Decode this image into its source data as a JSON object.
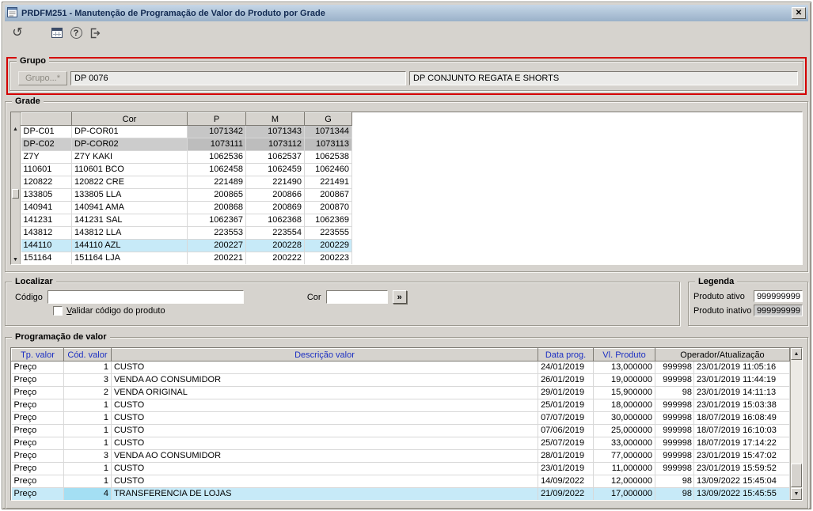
{
  "window": {
    "title": "PRDFM251 - Manutenção de Programação de Valor do Produto por Grade",
    "close_glyph": "✕"
  },
  "toolbar": {
    "icons": [
      "undo-icon",
      "calendar-icon",
      "help-icon",
      "exit-icon"
    ]
  },
  "grupo": {
    "legend": "Grupo",
    "button_label": "Grupo...*",
    "code": "DP 0076",
    "description": "DP CONJUNTO REGATA E SHORTS"
  },
  "grade": {
    "legend": "Grade",
    "headers": {
      "code": "",
      "cor": "Cor",
      "p": "P",
      "m": "M",
      "g": "G"
    },
    "rows": [
      {
        "code": "DP-C01",
        "cor": "DP-COR01",
        "p": "1071342",
        "m": "1071343",
        "g": "1071344",
        "state": "nums-gray"
      },
      {
        "code": "DP-C02",
        "cor": "DP-COR02",
        "p": "1073111",
        "m": "1073112",
        "g": "1073113",
        "state": "row-gray"
      },
      {
        "code": "Z7Y",
        "cor": "Z7Y KAKI",
        "p": "1062536",
        "m": "1062537",
        "g": "1062538",
        "state": ""
      },
      {
        "code": "110601",
        "cor": "110601 BCO",
        "p": "1062458",
        "m": "1062459",
        "g": "1062460",
        "state": ""
      },
      {
        "code": "120822",
        "cor": "120822 CRE",
        "p": "221489",
        "m": "221490",
        "g": "221491",
        "state": ""
      },
      {
        "code": "133805",
        "cor": "133805 LLA",
        "p": "200865",
        "m": "200866",
        "g": "200867",
        "state": ""
      },
      {
        "code": "140941",
        "cor": "140941 AMA",
        "p": "200868",
        "m": "200869",
        "g": "200870",
        "state": ""
      },
      {
        "code": "141231",
        "cor": "141231 SAL",
        "p": "1062367",
        "m": "1062368",
        "g": "1062369",
        "state": ""
      },
      {
        "code": "143812",
        "cor": "143812 LLA",
        "p": "223553",
        "m": "223554",
        "g": "223555",
        "state": ""
      },
      {
        "code": "144110",
        "cor": "144110 AZL",
        "p": "200227",
        "m": "200228",
        "g": "200229",
        "state": "selected"
      },
      {
        "code": "151164",
        "cor": "151164 LJA",
        "p": "200221",
        "m": "200222",
        "g": "200223",
        "state": ""
      }
    ]
  },
  "localizar": {
    "legend": "Localizar",
    "codigo_label": "Código",
    "codigo_value": "",
    "checkbox_label": "Validar código do produto",
    "cor_label": "Cor",
    "cor_value": "",
    "go_label": "»"
  },
  "legenda": {
    "legend": "Legenda",
    "ativo_label": "Produto ativo",
    "ativo_value": "999999999",
    "inativo_label": "Produto inativo",
    "inativo_value": "999999999"
  },
  "programacao": {
    "legend": "Programação de valor",
    "headers": {
      "tp": "Tp. valor",
      "cod": "Cód. valor",
      "desc": "Descrição valor",
      "data": "Data prog.",
      "valor": "Vl. Produto",
      "oper": "Operador/Atualização"
    },
    "rows": [
      {
        "tp": "Preço",
        "cod": "1",
        "desc": "CUSTO",
        "data": "24/01/2019",
        "valor": "13,000000",
        "oper": "999998",
        "atual": "23/01/2019 11:05:16",
        "state": ""
      },
      {
        "tp": "Preço",
        "cod": "3",
        "desc": "VENDA AO CONSUMIDOR",
        "data": "26/01/2019",
        "valor": "19,000000",
        "oper": "999998",
        "atual": "23/01/2019 11:44:19",
        "state": ""
      },
      {
        "tp": "Preço",
        "cod": "2",
        "desc": "VENDA ORIGINAL",
        "data": "29/01/2019",
        "valor": "15,900000",
        "oper": "98",
        "atual": "23/01/2019 14:11:13",
        "state": ""
      },
      {
        "tp": "Preço",
        "cod": "1",
        "desc": "CUSTO",
        "data": "25/01/2019",
        "valor": "18,000000",
        "oper": "999998",
        "atual": "23/01/2019 15:03:38",
        "state": ""
      },
      {
        "tp": "Preço",
        "cod": "1",
        "desc": "CUSTO",
        "data": "07/07/2019",
        "valor": "30,000000",
        "oper": "999998",
        "atual": "18/07/2019 16:08:49",
        "state": ""
      },
      {
        "tp": "Preço",
        "cod": "1",
        "desc": "CUSTO",
        "data": "07/06/2019",
        "valor": "25,000000",
        "oper": "999998",
        "atual": "18/07/2019 16:10:03",
        "state": ""
      },
      {
        "tp": "Preço",
        "cod": "1",
        "desc": "CUSTO",
        "data": "25/07/2019",
        "valor": "33,000000",
        "oper": "999998",
        "atual": "18/07/2019 17:14:22",
        "state": ""
      },
      {
        "tp": "Preço",
        "cod": "3",
        "desc": "VENDA AO CONSUMIDOR",
        "data": "28/01/2019",
        "valor": "77,000000",
        "oper": "999998",
        "atual": "23/01/2019 15:47:02",
        "state": ""
      },
      {
        "tp": "Preço",
        "cod": "1",
        "desc": "CUSTO",
        "data": "23/01/2019",
        "valor": "11,000000",
        "oper": "999998",
        "atual": "23/01/2019 15:59:52",
        "state": ""
      },
      {
        "tp": "Preço",
        "cod": "1",
        "desc": "CUSTO",
        "data": "14/09/2022",
        "valor": "12,000000",
        "oper": "98",
        "atual": "13/09/2022 15:45:04",
        "state": ""
      },
      {
        "tp": "Preço",
        "cod": "4",
        "desc": "TRANSFERENCIA DE LOJAS",
        "data": "21/09/2022",
        "valor": "17,000000",
        "oper": "98",
        "atual": "13/09/2022 15:45:55",
        "state": "selected"
      }
    ]
  },
  "colors": {
    "annotation_red": "#d40000",
    "selection_blue": "#c7eaf8",
    "inactive_gray": "#c6c6c6",
    "header_blue": "#1c2fc2",
    "window_gray": "#d6d3ce"
  }
}
